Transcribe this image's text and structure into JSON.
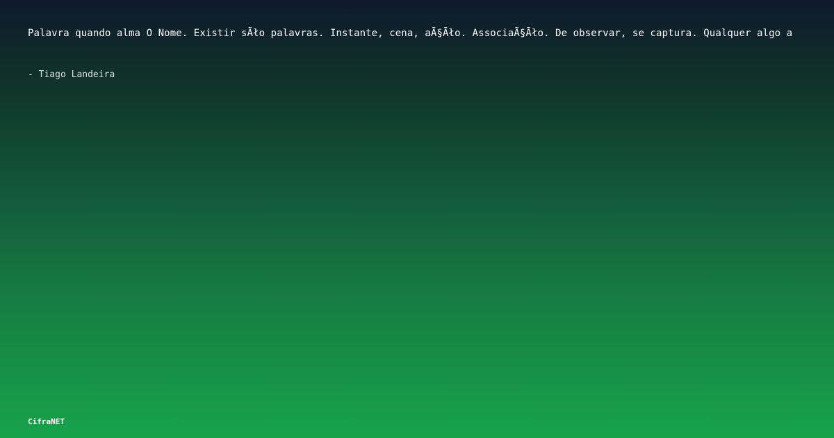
{
  "quote": {
    "text": "Palavra quando alma O Nome. Existir sÃło palavras. Instante, cena, aÃ§Ãło. AssociaÃ§Ãło. De observar, se captura. Qualquer algo a"
  },
  "author": {
    "text": "- Tiago Landeira"
  },
  "brand": {
    "text": "CifraNET"
  }
}
